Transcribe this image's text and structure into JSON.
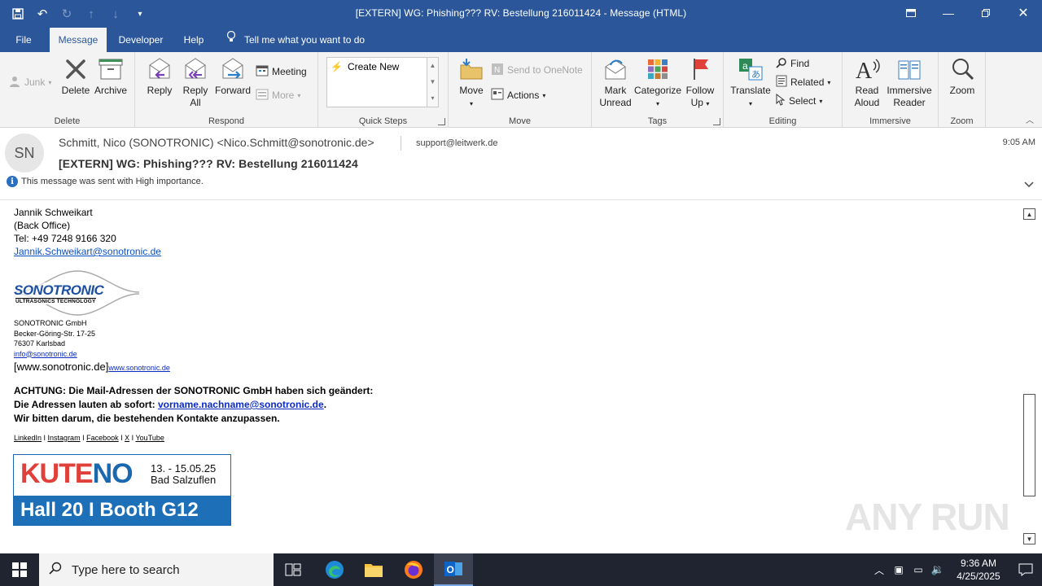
{
  "window": {
    "title": "[EXTERN] WG: Phishing???  RV: Bestellung 216011424  -  Message (HTML)"
  },
  "tabs": [
    "File",
    "Message",
    "Developer",
    "Help"
  ],
  "tell_me": "Tell me what you want to do",
  "ribbon": {
    "junk": "Junk",
    "delete": "Delete",
    "archive": "Archive",
    "group_delete": "Delete",
    "reply": "Reply",
    "reply_all_1": "Reply",
    "reply_all_2": "All",
    "forward": "Forward",
    "meeting": "Meeting",
    "more": "More",
    "group_respond": "Respond",
    "create_new": "Create New",
    "group_quick_steps": "Quick Steps",
    "move": "Move",
    "send_onenote": "Send to OneNote",
    "actions": "Actions",
    "group_move": "Move",
    "mark_unread_1": "Mark",
    "mark_unread_2": "Unread",
    "categorize": "Categorize",
    "follow_up_1": "Follow",
    "follow_up_2": "Up",
    "group_tags": "Tags",
    "translate": "Translate",
    "find": "Find",
    "related": "Related",
    "select": "Select",
    "group_editing": "Editing",
    "read_aloud_1": "Read",
    "read_aloud_2": "Aloud",
    "immersive_1": "Immersive",
    "immersive_2": "Reader",
    "group_immersive": "Immersive",
    "zoom": "Zoom",
    "group_zoom": "Zoom"
  },
  "message": {
    "avatar_initials": "SN",
    "from": "Schmitt, Nico (SONOTRONIC) <Nico.Schmitt@sonotronic.de>",
    "to": "support@leitwerk.de",
    "time": "9:05 AM",
    "subject": "[EXTERN] WG: Phishing???   RV: Bestellung 216011424",
    "importance": "This message was sent with High importance."
  },
  "body": {
    "name": "Jannik Schweikart",
    "role": "(Back Office)",
    "tel": "Tel: +49 7248 9166 320",
    "email": "Jannik.Schweikart@sonotronic.de",
    "logo_main": "SONOTRONIC",
    "logo_sub": "ULTRASONICS TECHNOLOGY",
    "company": "SONOTRONIC GmbH",
    "street": "Becker-Göring-Str. 17-25",
    "city": "76307 Karlsbad",
    "info_email": "info@sonotronic.de",
    "web_bracket": "[www.sonotronic.de]",
    "web_link": "www.sonotronic.de",
    "notice_1": "ACHTUNG:  Die Mail-Adressen  der SONOTRONIC GmbH haben sich geändert:",
    "notice_2_prefix": "Die Adressen  lauten ab sofort: ",
    "notice_2_link": "vorname.nachname@sonotronic.de",
    "notice_2_suffix": ".",
    "notice_3": "Wir bitten darum, die bestehenden Kontakte anzupassen.",
    "social": [
      "LinkedIn",
      "Instagram",
      "Facebook",
      "X",
      "YouTube"
    ],
    "banner_kute": "KUTE",
    "banner_no": "NO",
    "banner_dates": "13. - 15.05.25",
    "banner_place": "Bad Salzuflen",
    "banner_hall": "Hall 20  I  Booth  G12"
  },
  "watermark": "ANY RUN",
  "taskbar": {
    "search_placeholder": "Type here to search",
    "time": "9:36 AM",
    "date": "4/25/2025"
  },
  "colors": {
    "title_bar": "#2b579a",
    "taskbar": "#1f2430",
    "link": "#0b51c1"
  }
}
